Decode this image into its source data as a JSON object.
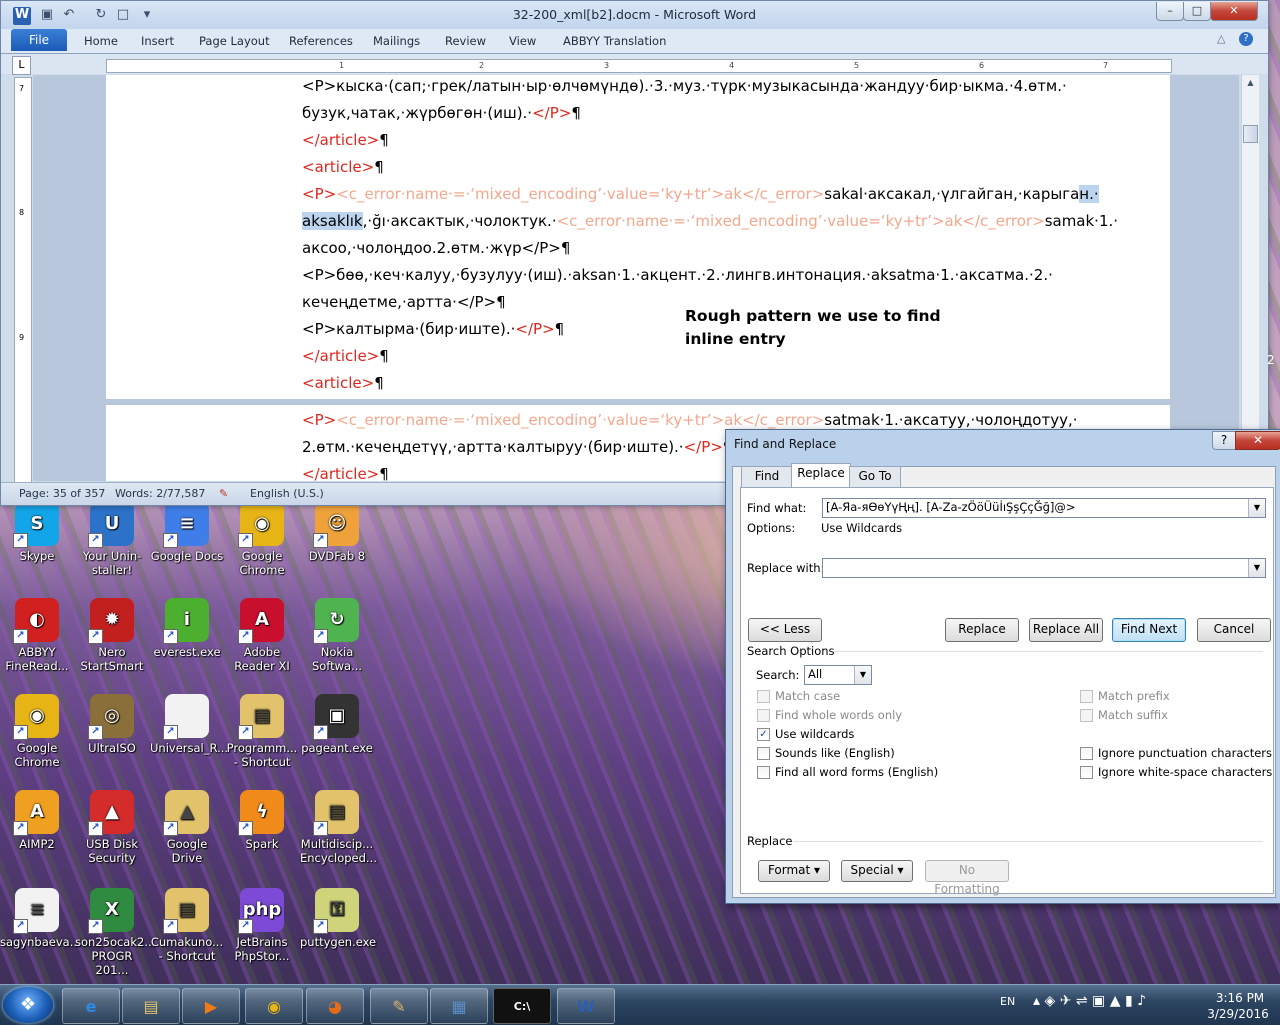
{
  "word": {
    "title": "32-200_xml[b2].docm - Microsoft Word",
    "tabs": [
      "File",
      "Home",
      "Insert",
      "Page Layout",
      "References",
      "Mailings",
      "Review",
      "View",
      "ABBYY Translation"
    ],
    "ruler_numbers": [
      "1",
      "1",
      "2",
      "3",
      "4",
      "5",
      "6",
      "7"
    ],
    "vruler_numbers": [
      "7",
      "8",
      "9"
    ],
    "lines": [
      {
        "parts": [
          {
            "t": "<P>кыска·(сап;·грек/латын·ыр·өлчөмүндө).·3.·муз.·түрк·музыкасында·жандуу·бир·ыкма.·4.өтм.·",
            "c": ""
          }
        ]
      },
      {
        "parts": [
          {
            "t": "бузук,чатак,·жүрбөгөн·(иш).·",
            "c": ""
          },
          {
            "t": "</P>",
            "c": "red"
          },
          {
            "t": "¶",
            "c": ""
          }
        ]
      },
      {
        "parts": [
          {
            "t": "</article>",
            "c": "red"
          },
          {
            "t": "¶",
            "c": ""
          }
        ]
      },
      {
        "parts": [
          {
            "t": "<article>",
            "c": "red"
          },
          {
            "t": "¶",
            "c": ""
          }
        ]
      },
      {
        "parts": [
          {
            "t": "<P>",
            "c": "red"
          },
          {
            "t": "<c_error·name·=·‘mixed_encoding’·value=‘ky+tr’>ak</c_error>",
            "c": "salmon"
          },
          {
            "t": "sakal·аксакал,·үлгайган,·карыга",
            "c": ""
          },
          {
            "t": "н.·",
            "c": "hl"
          }
        ]
      },
      {
        "parts": [
          {
            "t": "aksaklık",
            "c": "hl"
          },
          {
            "t": ",·ğı·аксактык,·чолоктук.·",
            "c": ""
          },
          {
            "t": "<c_error·name·=·‘mixed_encoding’·value=‘ky+tr’>ak</c_error>",
            "c": "salmon"
          },
          {
            "t": "samak·1.·",
            "c": ""
          }
        ]
      },
      {
        "parts": [
          {
            "t": "аксоо,·чолоңдоо.2.өтм.·жүр</P>¶",
            "c": ""
          }
        ]
      },
      {
        "parts": [
          {
            "t": "<P>бөө,·кеч·калуу,·бузулуу·(иш).·aksan·1.·акцент.·2.·лингв.интонация.·aksatma·1.·аксатма.·2.·",
            "c": ""
          }
        ]
      },
      {
        "parts": [
          {
            "t": "кечеңдетме,·артта·</P>¶",
            "c": ""
          }
        ]
      },
      {
        "parts": [
          {
            "t": "<P>калтырма·(бир·иште).·",
            "c": ""
          },
          {
            "t": "</P>",
            "c": "red"
          },
          {
            "t": "¶",
            "c": ""
          }
        ]
      },
      {
        "parts": [
          {
            "t": "</article>",
            "c": "red"
          },
          {
            "t": "¶",
            "c": ""
          }
        ]
      },
      {
        "parts": [
          {
            "t": "<article>",
            "c": "red"
          },
          {
            "t": "¶",
            "c": ""
          }
        ]
      }
    ],
    "lines_page2": [
      {
        "parts": [
          {
            "t": "<P>",
            "c": "red"
          },
          {
            "t": "<c_error·name·=·‘mixed_encoding’·value=‘ky+tr’>ak</c_error>",
            "c": "salmon"
          },
          {
            "t": "satmak·1.·аксатуу,·чолоңдотуу,·",
            "c": ""
          }
        ]
      },
      {
        "parts": [
          {
            "t": "2.өтм.·кечеңдетүү,·артта·калтыруу·(бир·иште).·",
            "c": ""
          },
          {
            "t": "</P>",
            "c": "red"
          },
          {
            "t": "¶",
            "c": ""
          }
        ]
      },
      {
        "parts": [
          {
            "t": "</article>",
            "c": "red"
          },
          {
            "t": "¶",
            "c": ""
          }
        ]
      }
    ],
    "annotation": "Rough pattern we use to find inline entry",
    "status": {
      "page": "Page: 35 of 357",
      "words": "Words: 2/77,587",
      "language": "English (U.S.)"
    },
    "side_number": "2"
  },
  "dialog": {
    "title": "Find and Replace",
    "help": "?",
    "tabs": [
      "Find",
      "Replace",
      "Go To"
    ],
    "find_label": "Find what:",
    "find_value": "[A-Яа-яӨөҮүҢң]. [A-Za-zÖöÜüİıŞşÇçĞğ]@>",
    "options_label": "Options:",
    "options_value": "Use Wildcards",
    "replace_label": "Replace with:",
    "replace_value": "",
    "buttons": {
      "less": "<< Less",
      "replace": "Replace",
      "replace_all": "Replace All",
      "find_next": "Find Next",
      "cancel": "Cancel"
    },
    "search_options_label": "Search Options",
    "search_label": "Search:",
    "search_value": "All",
    "left_checks": [
      {
        "label": "Match case",
        "checked": false,
        "disabled": true
      },
      {
        "label": "Find whole words only",
        "checked": false,
        "disabled": true
      },
      {
        "label": "Use wildcards",
        "checked": true,
        "disabled": false
      },
      {
        "label": "Sounds like (English)",
        "checked": false,
        "disabled": false
      },
      {
        "label": "Find all word forms (English)",
        "checked": false,
        "disabled": false
      }
    ],
    "right_checks": [
      {
        "label": "Match prefix",
        "checked": false,
        "disabled": true
      },
      {
        "label": "Match suffix",
        "checked": false,
        "disabled": true
      },
      {
        "label": "Ignore punctuation characters",
        "checked": false,
        "disabled": false
      },
      {
        "label": "Ignore white-space characters",
        "checked": false,
        "disabled": false
      }
    ],
    "replace_section": "Replace",
    "format_btn": "Format ▾",
    "special_btn": "Special ▾",
    "no_formatting_btn": "No Formatting"
  },
  "desktop_icons": [
    {
      "label": "Skype",
      "color": "#12a5e8",
      "glyph": "S"
    },
    {
      "label": "Your Unin-staller!",
      "color": "#2c72c8",
      "glyph": "U"
    },
    {
      "label": "Google Docs",
      "color": "#3f7ee8",
      "glyph": "≡"
    },
    {
      "label": "Google Chrome",
      "color": "#e7b416",
      "glyph": "◉"
    },
    {
      "label": "DVDFab 8",
      "color": "#f0a23a",
      "glyph": "☺"
    },
    {
      "label": "ABBYY FineRead...",
      "color": "#d12020",
      "glyph": "◐"
    },
    {
      "label": "Nero StartSmart",
      "color": "#c21f1f",
      "glyph": "✹"
    },
    {
      "label": "everest.exe",
      "color": "#4caf2f",
      "glyph": "i"
    },
    {
      "label": "Adobe Reader XI",
      "color": "#c8102e",
      "glyph": "A"
    },
    {
      "label": "Nokia Softwa...",
      "color": "#4fb34f",
      "glyph": "↻"
    },
    {
      "label": "Google Chrome",
      "color": "#e7b416",
      "glyph": "◉"
    },
    {
      "label": "UltraISO",
      "color": "#8a6f3a",
      "glyph": "◎"
    },
    {
      "label": "Universal_R...",
      "color": "#f2f2f2",
      "glyph": ""
    },
    {
      "label": "Programm... - Shortcut",
      "color": "#e2c36b",
      "glyph": "▤"
    },
    {
      "label": "pageant.exe",
      "color": "#333333",
      "glyph": "▣"
    },
    {
      "label": "AIMP2",
      "color": "#f0a020",
      "glyph": "A"
    },
    {
      "label": "USB Disk Security",
      "color": "#d42b2b",
      "glyph": "▲"
    },
    {
      "label": "Google Drive",
      "color": "#e2c36b",
      "glyph": "▲"
    },
    {
      "label": "Spark",
      "color": "#f08a1a",
      "glyph": "ϟ"
    },
    {
      "label": "Multidiscip... Encycloped...",
      "color": "#e2c36b",
      "glyph": "▤"
    },
    {
      "label": "sagynbaeva...",
      "color": "#f2f2f2",
      "glyph": "≡"
    },
    {
      "label": "son25ocak2... PROGR 201...",
      "color": "#2e8b3f",
      "glyph": "X"
    },
    {
      "label": "Cumakuno... - Shortcut",
      "color": "#e2c36b",
      "glyph": "▤"
    },
    {
      "label": "JetBrains PhpStor...",
      "color": "#7c4ad6",
      "glyph": "php"
    },
    {
      "label": "puttygen.exe",
      "color": "#cfd47a",
      "glyph": "⚿"
    }
  ],
  "taskbar": {
    "items": [
      {
        "name": "internet-explorer",
        "glyph": "e",
        "color": "#2d8ae5"
      },
      {
        "name": "file-explorer",
        "glyph": "▤",
        "color": "#e2c36b"
      },
      {
        "name": "media-player",
        "glyph": "▶",
        "color": "#f07a1a"
      },
      {
        "name": "chrome",
        "glyph": "◉",
        "color": "#e7b416"
      },
      {
        "name": "firefox",
        "glyph": "◕",
        "color": "#e56a1a"
      },
      {
        "name": "paint",
        "glyph": "✎",
        "color": "#d9b36a"
      },
      {
        "name": "photo-viewer",
        "glyph": "▦",
        "color": "#5a8fc8"
      },
      {
        "name": "command-prompt",
        "glyph": "C:\\",
        "color": "#000000"
      },
      {
        "name": "word",
        "glyph": "W",
        "color": "#2b5faf"
      }
    ],
    "lang": "EN",
    "time": "3:16 PM",
    "date": "3/29/2016"
  }
}
